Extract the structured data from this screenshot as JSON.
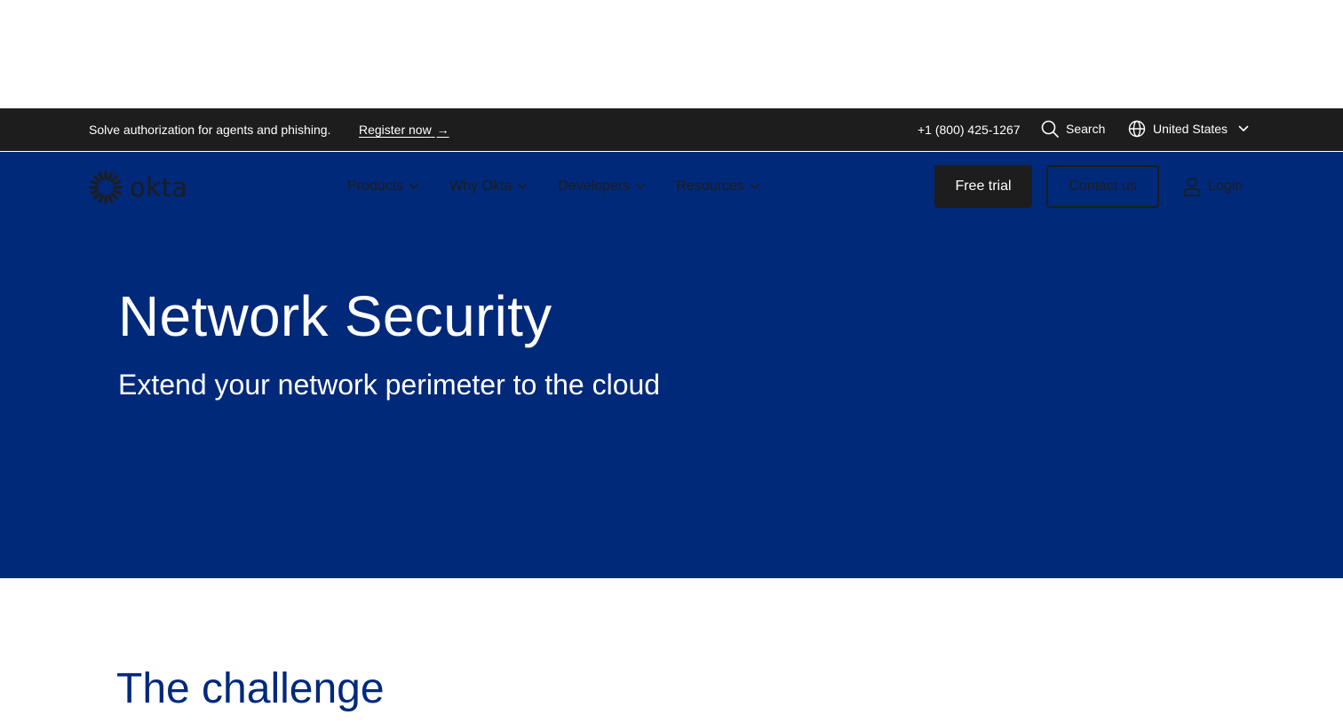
{
  "announcement": {
    "text": "Solve authorization for agents and phishing.",
    "link_label": "Register now",
    "link_arrow": "→"
  },
  "utility": {
    "phone": "+1 (800) 425-1267",
    "search_label": "Search",
    "region_label": "United States"
  },
  "brand": {
    "wordmark": "okta"
  },
  "nav": {
    "items": [
      {
        "label": "Products"
      },
      {
        "label": "Why Okta"
      },
      {
        "label": "Developers"
      },
      {
        "label": "Resources"
      }
    ]
  },
  "actions": {
    "free_trial": "Free trial",
    "contact_us": "Contact us",
    "login": "Login"
  },
  "hero": {
    "title": "Network Security",
    "subtitle": "Extend your network perimeter to the cloud"
  },
  "section": {
    "title": "The challenge"
  },
  "colors": {
    "hero_background": "#00297a",
    "announcement_background": "#1d1d1d",
    "nav_text": "#1d1d1d",
    "section_title": "#00297a"
  },
  "icons": {
    "search": "search-icon",
    "globe": "globe-icon",
    "chevron": "chevron-down-icon",
    "user": "user-icon",
    "logo": "okta-sunburst-icon"
  }
}
